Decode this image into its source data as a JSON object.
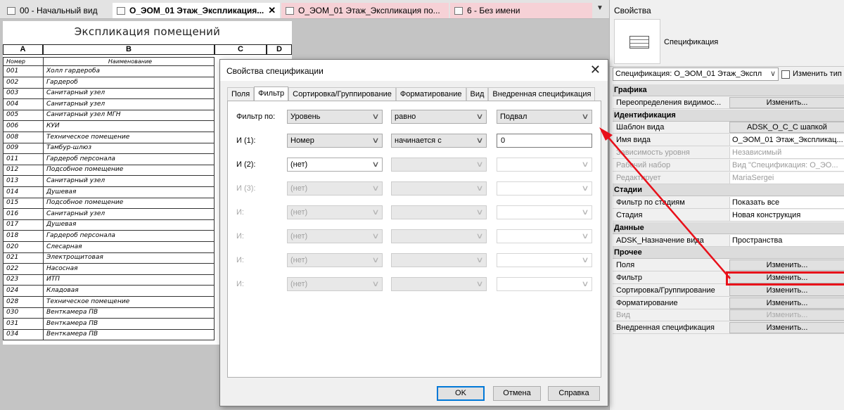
{
  "tabs": [
    {
      "label": "00 - Начальный вид",
      "active": false
    },
    {
      "label": "О_ЭОМ_01 Этаж_Экспликация...",
      "active": true
    },
    {
      "label": "О_ЭОМ_01 Этаж_Экспликация по...",
      "active": false
    },
    {
      "label": "6 - Без имени",
      "active": false
    }
  ],
  "tab_close": "✕",
  "schedule": {
    "title": "Экспликация помещений",
    "columns": [
      "A",
      "B",
      "C",
      "D"
    ],
    "headers": [
      "Номер",
      "Наименование"
    ],
    "rows": [
      [
        "001",
        "Холл гардероба"
      ],
      [
        "002",
        "Гардероб"
      ],
      [
        "003",
        "Санитарный узел"
      ],
      [
        "004",
        "Санитарный узел"
      ],
      [
        "005",
        "Санитарный узел МГН"
      ],
      [
        "006",
        "КУИ"
      ],
      [
        "008",
        "Техническое помещение"
      ],
      [
        "009",
        "Тамбур-шлюз"
      ],
      [
        "011",
        "Гардероб персонала"
      ],
      [
        "012",
        "Подсобное помещение"
      ],
      [
        "013",
        "Санитарный узел"
      ],
      [
        "014",
        "Душевая"
      ],
      [
        "015",
        "Подсобное помещение"
      ],
      [
        "016",
        "Санитарный узел"
      ],
      [
        "017",
        "Душевая"
      ],
      [
        "018",
        "Гардероб персонала"
      ],
      [
        "020",
        "Слесарная"
      ],
      [
        "021",
        "Электрощитовая"
      ],
      [
        "022",
        "Насосная"
      ],
      [
        "023",
        "ИТП"
      ],
      [
        "024",
        "Кладовая"
      ],
      [
        "028",
        "Техническое помещение"
      ],
      [
        "030",
        "Венткамера ПВ"
      ],
      [
        "031",
        "Венткамера ПВ"
      ],
      [
        "034",
        "Венткамера ПВ"
      ]
    ]
  },
  "dialog": {
    "title": "Свойства спецификации",
    "close": "✕",
    "tabs": [
      "Поля",
      "Фильтр",
      "Сортировка/Группирование",
      "Форматирование",
      "Вид",
      "Внедренная спецификация"
    ],
    "active_tab": "Фильтр",
    "filters": [
      {
        "label": "Фильтр по:",
        "field": "Уровень",
        "operator": "равно",
        "value": "Подвал",
        "value_is_combo": true,
        "state": "active"
      },
      {
        "label": "И (1):",
        "field": "Номер",
        "operator": "начинается с",
        "value": "0",
        "value_is_combo": false,
        "state": "active"
      },
      {
        "label": "И (2):",
        "field": "(нет)",
        "operator": "",
        "value": "",
        "value_is_combo": true,
        "state": "partial"
      },
      {
        "label": "И (3):",
        "field": "(нет)",
        "operator": "",
        "value": "",
        "value_is_combo": true,
        "state": "disabled"
      },
      {
        "label": "И:",
        "field": "(нет)",
        "operator": "",
        "value": "",
        "value_is_combo": true,
        "state": "disabled"
      },
      {
        "label": "И:",
        "field": "(нет)",
        "operator": "",
        "value": "",
        "value_is_combo": true,
        "state": "disabled"
      },
      {
        "label": "И:",
        "field": "(нет)",
        "operator": "",
        "value": "",
        "value_is_combo": true,
        "state": "disabled"
      },
      {
        "label": "И:",
        "field": "(нет)",
        "operator": "",
        "value": "",
        "value_is_combo": true,
        "state": "disabled"
      }
    ],
    "buttons": {
      "ok": "OK",
      "cancel": "Отмена",
      "help": "Справка"
    }
  },
  "properties": {
    "title": "Свойства",
    "type_name": "Спецификация",
    "view_selector": "Спецификация: О_ЭОМ_01 Этаж_Экспл",
    "edit_type": "Изменить тип",
    "rows": [
      {
        "kind": "section",
        "name": "Графика"
      },
      {
        "kind": "button",
        "name": "Переопределения видимос...",
        "value": "Изменить..."
      },
      {
        "kind": "section",
        "name": "Идентификация"
      },
      {
        "kind": "button",
        "name": "Шаблон вида",
        "value": "ADSK_О_С_С шапкой"
      },
      {
        "kind": "value",
        "name": "Имя вида",
        "value": "О_ЭОМ_01 Этаж_Экспликац..."
      },
      {
        "kind": "value",
        "name": "Зависимость уровня",
        "value": "Независимый",
        "disabled": true
      },
      {
        "kind": "value",
        "name": "Рабочий набор",
        "value": "Вид \"Спецификация: О_ЭО...",
        "disabled": true
      },
      {
        "kind": "value",
        "name": "Редактирует",
        "value": "MariaSergei",
        "disabled": true
      },
      {
        "kind": "section",
        "name": "Стадии"
      },
      {
        "kind": "value",
        "name": "Фильтр по стадиям",
        "value": "Показать все"
      },
      {
        "kind": "value",
        "name": "Стадия",
        "value": "Новая конструкция"
      },
      {
        "kind": "section",
        "name": "Данные"
      },
      {
        "kind": "value",
        "name": "ADSK_Назначение вида",
        "value": "Пространства"
      },
      {
        "kind": "section",
        "name": "Прочее"
      },
      {
        "kind": "button",
        "name": "Поля",
        "value": "Изменить..."
      },
      {
        "kind": "button",
        "name": "Фильтр",
        "value": "Изменить..."
      },
      {
        "kind": "button",
        "name": "Сортировка/Группирование",
        "value": "Изменить..."
      },
      {
        "kind": "button",
        "name": "Форматирование",
        "value": "Изменить..."
      },
      {
        "kind": "button",
        "name": "Вид",
        "value": "Изменить...",
        "disabled": true
      },
      {
        "kind": "button",
        "name": "Внедренная спецификация",
        "value": "Изменить..."
      }
    ]
  },
  "colors": {
    "highlight": "#e8101a",
    "focus": "#0078d7",
    "active_tab": "#f6d1d6"
  },
  "icons": [
    "table-icon",
    "schedule-type-icon",
    "edit-type-icon",
    "chevron-down-icon",
    "close-icon",
    "red-arrow-annotation"
  ]
}
